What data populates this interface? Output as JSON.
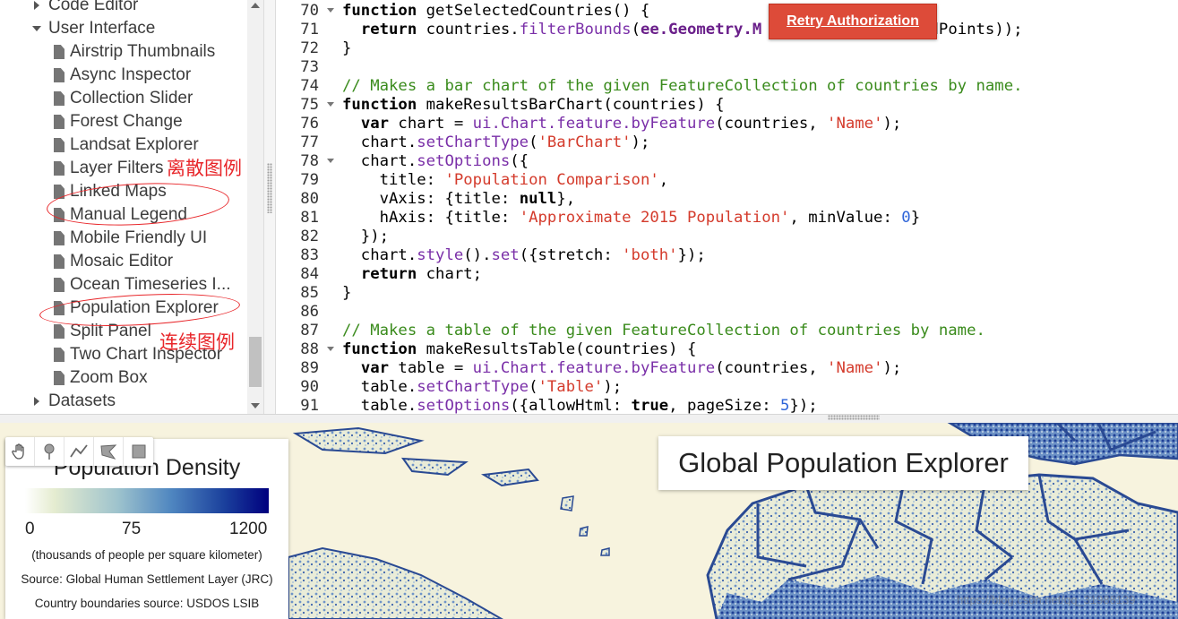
{
  "tree": {
    "items": [
      {
        "label": "Code Editor",
        "kind": "folder-collapsed"
      },
      {
        "label": "User Interface",
        "kind": "folder-expanded"
      },
      {
        "label": "Airstrip Thumbnails",
        "kind": "file"
      },
      {
        "label": "Async Inspector",
        "kind": "file"
      },
      {
        "label": "Collection Slider",
        "kind": "file"
      },
      {
        "label": "Forest Change",
        "kind": "file"
      },
      {
        "label": "Landsat Explorer",
        "kind": "file"
      },
      {
        "label": "Layer Filters",
        "kind": "file"
      },
      {
        "label": "Linked Maps",
        "kind": "file"
      },
      {
        "label": "Manual Legend",
        "kind": "file"
      },
      {
        "label": "Mobile Friendly UI",
        "kind": "file"
      },
      {
        "label": "Mosaic Editor",
        "kind": "file"
      },
      {
        "label": "Ocean Timeseries I...",
        "kind": "file"
      },
      {
        "label": "Population Explorer",
        "kind": "file"
      },
      {
        "label": "Split Panel",
        "kind": "file"
      },
      {
        "label": "Two Chart Inspector",
        "kind": "file"
      },
      {
        "label": "Zoom Box",
        "kind": "file"
      },
      {
        "label": "Datasets",
        "kind": "folder-collapsed"
      }
    ]
  },
  "annotations": {
    "discrete_legend": "离散图例",
    "continuous_legend": "连续图例",
    "color": "#e8262a"
  },
  "editor": {
    "lines": [
      {
        "n": "70",
        "fold": true,
        "tokens": [
          [
            "kw",
            "function"
          ],
          [
            "code",
            " getSelectedCountries() {"
          ]
        ]
      },
      {
        "n": "71",
        "fold": false,
        "tokens": [
          [
            "code",
            "  "
          ],
          [
            "kw",
            "return"
          ],
          [
            "code",
            " countries."
          ],
          [
            "fn",
            "filterBounds"
          ],
          [
            "code",
            "("
          ],
          [
            "cls",
            "ee.Geometry.M"
          ],
          [
            "code",
            "                 edPoints));"
          ]
        ]
      },
      {
        "n": "72",
        "fold": false,
        "tokens": [
          [
            "code",
            "}"
          ]
        ]
      },
      {
        "n": "73",
        "fold": false,
        "tokens": []
      },
      {
        "n": "74",
        "fold": false,
        "tokens": [
          [
            "cm",
            "// Makes a bar chart of the given FeatureCollection of countries by name."
          ]
        ]
      },
      {
        "n": "75",
        "fold": true,
        "tokens": [
          [
            "kw",
            "function"
          ],
          [
            "code",
            " makeResultsBarChart(countries) {"
          ]
        ]
      },
      {
        "n": "76",
        "fold": false,
        "tokens": [
          [
            "code",
            "  "
          ],
          [
            "kw",
            "var"
          ],
          [
            "code",
            " chart = "
          ],
          [
            "fn",
            "ui.Chart.feature.byFeature"
          ],
          [
            "code",
            "(countries, "
          ],
          [
            "str",
            "'Name'"
          ],
          [
            "code",
            ");"
          ]
        ]
      },
      {
        "n": "77",
        "fold": false,
        "tokens": [
          [
            "code",
            "  chart."
          ],
          [
            "fn",
            "setChartType"
          ],
          [
            "code",
            "("
          ],
          [
            "str",
            "'BarChart'"
          ],
          [
            "code",
            ");"
          ]
        ]
      },
      {
        "n": "78",
        "fold": true,
        "tokens": [
          [
            "code",
            "  chart."
          ],
          [
            "fn",
            "setOptions"
          ],
          [
            "code",
            "({"
          ]
        ]
      },
      {
        "n": "79",
        "fold": false,
        "tokens": [
          [
            "code",
            "    title: "
          ],
          [
            "str",
            "'Population Comparison'"
          ],
          [
            "code",
            ","
          ]
        ]
      },
      {
        "n": "80",
        "fold": false,
        "tokens": [
          [
            "code",
            "    vAxis: {title: "
          ],
          [
            "kw",
            "null"
          ],
          [
            "code",
            "},"
          ]
        ]
      },
      {
        "n": "81",
        "fold": false,
        "tokens": [
          [
            "code",
            "    hAxis: {title: "
          ],
          [
            "str",
            "'Approximate 2015 Population'"
          ],
          [
            "code",
            ", minValue: "
          ],
          [
            "num",
            "0"
          ],
          [
            "code",
            "}"
          ]
        ]
      },
      {
        "n": "82",
        "fold": false,
        "tokens": [
          [
            "code",
            "  });"
          ]
        ]
      },
      {
        "n": "83",
        "fold": false,
        "tokens": [
          [
            "code",
            "  chart."
          ],
          [
            "fn",
            "style"
          ],
          [
            "code",
            "()."
          ],
          [
            "fn",
            "set"
          ],
          [
            "code",
            "({stretch: "
          ],
          [
            "str",
            "'both'"
          ],
          [
            "code",
            "});"
          ]
        ]
      },
      {
        "n": "84",
        "fold": false,
        "tokens": [
          [
            "code",
            "  "
          ],
          [
            "kw",
            "return"
          ],
          [
            "code",
            " chart;"
          ]
        ]
      },
      {
        "n": "85",
        "fold": false,
        "tokens": [
          [
            "code",
            "}"
          ]
        ]
      },
      {
        "n": "86",
        "fold": false,
        "tokens": []
      },
      {
        "n": "87",
        "fold": false,
        "tokens": [
          [
            "cm",
            "// Makes a table of the given FeatureCollection of countries by name."
          ]
        ]
      },
      {
        "n": "88",
        "fold": true,
        "tokens": [
          [
            "kw",
            "function"
          ],
          [
            "code",
            " makeResultsTable(countries) {"
          ]
        ]
      },
      {
        "n": "89",
        "fold": false,
        "tokens": [
          [
            "code",
            "  "
          ],
          [
            "kw",
            "var"
          ],
          [
            "code",
            " table = "
          ],
          [
            "fn",
            "ui.Chart.feature.byFeature"
          ],
          [
            "code",
            "(countries, "
          ],
          [
            "str",
            "'Name'"
          ],
          [
            "code",
            ");"
          ]
        ]
      },
      {
        "n": "90",
        "fold": false,
        "tokens": [
          [
            "code",
            "  table."
          ],
          [
            "fn",
            "setChartType"
          ],
          [
            "code",
            "("
          ],
          [
            "str",
            "'Table'"
          ],
          [
            "code",
            ");"
          ]
        ]
      },
      {
        "n": "91",
        "fold": false,
        "tokens": [
          [
            "code",
            "  table."
          ],
          [
            "fn",
            "setOptions"
          ],
          [
            "code",
            "({allowHtml: "
          ],
          [
            "kw",
            "true"
          ],
          [
            "code",
            ", pageSize: "
          ],
          [
            "num",
            "5"
          ],
          [
            "code",
            "});"
          ]
        ]
      }
    ]
  },
  "retry": {
    "label": "Retry Authorization",
    "color": "#dd4b39"
  },
  "toolbar": {
    "tools": [
      "hand-icon",
      "marker-icon",
      "line-icon",
      "polygon-icon",
      "rectangle-icon"
    ]
  },
  "legend": {
    "title": "Population Density",
    "min": "0",
    "mid": "75",
    "max": "1200",
    "note1": "(thousands of people per square kilometer)",
    "note2": "Source: Global Human Settlement Layer (JRC)",
    "note3": "Country boundaries source: USDOS LSIB",
    "low_color": "#ffffff",
    "high_color": "#00007e"
  },
  "app_title": "Global Population Explorer",
  "watermark": "https://blog.csdn.net/qq_31988139",
  "map": {
    "land_color": "#f7f3de",
    "border_color": "#2a4a93"
  }
}
